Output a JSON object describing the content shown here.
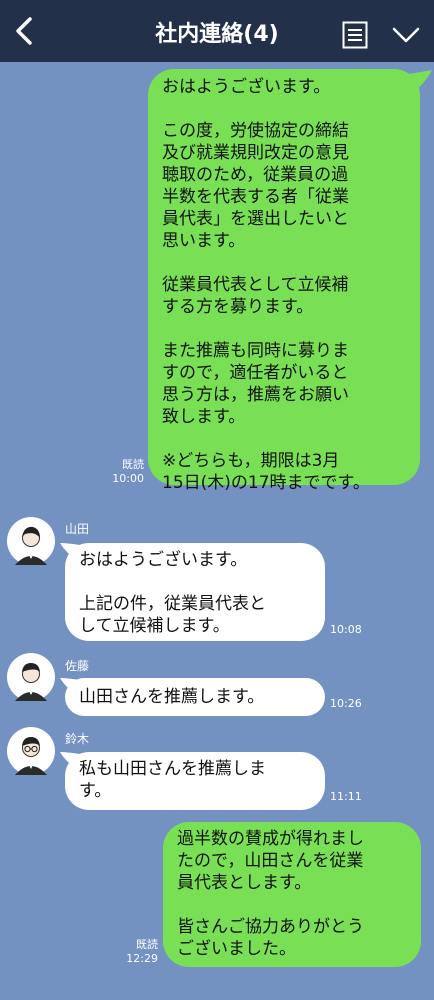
{
  "header": {
    "title": "社内連絡(4)",
    "back_icon": "chevron-left-icon",
    "menu_icon": "document-list-icon",
    "expand_icon": "chevron-down-icon"
  },
  "colors": {
    "header_bg": "#22304a",
    "chat_bg": "#7392c2",
    "sent_bubble": "#79e055",
    "received_bubble": "#ffffff"
  },
  "messages": [
    {
      "type": "sent",
      "read_label": "既読",
      "time": "10:00",
      "text": "おはようございます。\n\nこの度，労使協定の締結\n及び就業規則改定の意見\n聴取のため，従業員の過\n半数を代表する者「従業\n員代表」を選出したいと\n思います。\n\n従業員代表として立候補\nする方を募ります。\n\nまた推薦も同時に募りま\nすので，適任者がいると\n思う方は，推薦をお願い\n致します。\n\n※どちらも，期限は3月\n15日(木)の17時までです。"
    },
    {
      "type": "received",
      "sender": "山田",
      "avatar": "avatar-woman-icon",
      "time": "10:08",
      "text": "おはようございます。\n\n上記の件，従業員代表と\nして立候補します。"
    },
    {
      "type": "received",
      "sender": "佐藤",
      "avatar": "avatar-man-icon",
      "time": "10:26",
      "text": "山田さんを推薦します。"
    },
    {
      "type": "received",
      "sender": "鈴木",
      "avatar": "avatar-man-glasses-icon",
      "time": "11:11",
      "text": "私も山田さんを推薦しま\nす。"
    },
    {
      "type": "sent",
      "read_label": "既読",
      "time": "12:29",
      "text": "過半数の賛成が得れまし\nたので，山田さんを従業\n員代表とします。\n\n皆さんご協力ありがとう\nございました。"
    }
  ]
}
